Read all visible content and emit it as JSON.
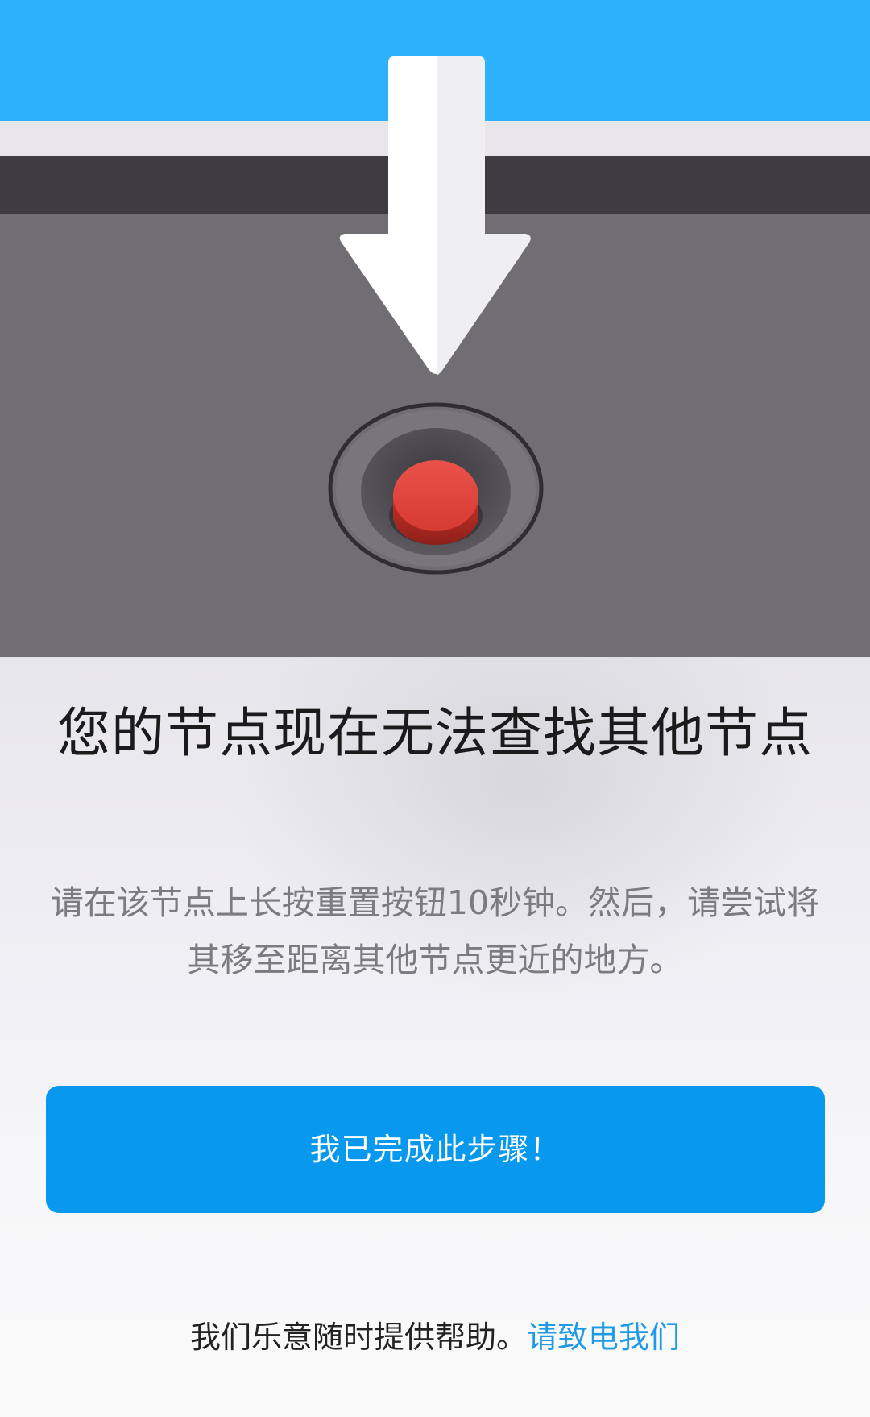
{
  "title": "您的节点现在无法查找其他节点",
  "description": "请在该节点上长按重置按钮10秒钟。然后，请尝试将其移至距离其他节点更近的地方。",
  "primary_button": {
    "label": "我已完成此步骤！"
  },
  "footer": {
    "text": "我们乐意随时提供帮助。",
    "link_label": "请致电我们"
  },
  "colors": {
    "accent_blue": "#2eb1fd",
    "button_blue": "#0899ee",
    "link_blue": "#1f9ae6",
    "reset_button_red": "#e0443a"
  },
  "illustration": {
    "icons": [
      "down-arrow-icon",
      "reset-button-icon"
    ]
  }
}
